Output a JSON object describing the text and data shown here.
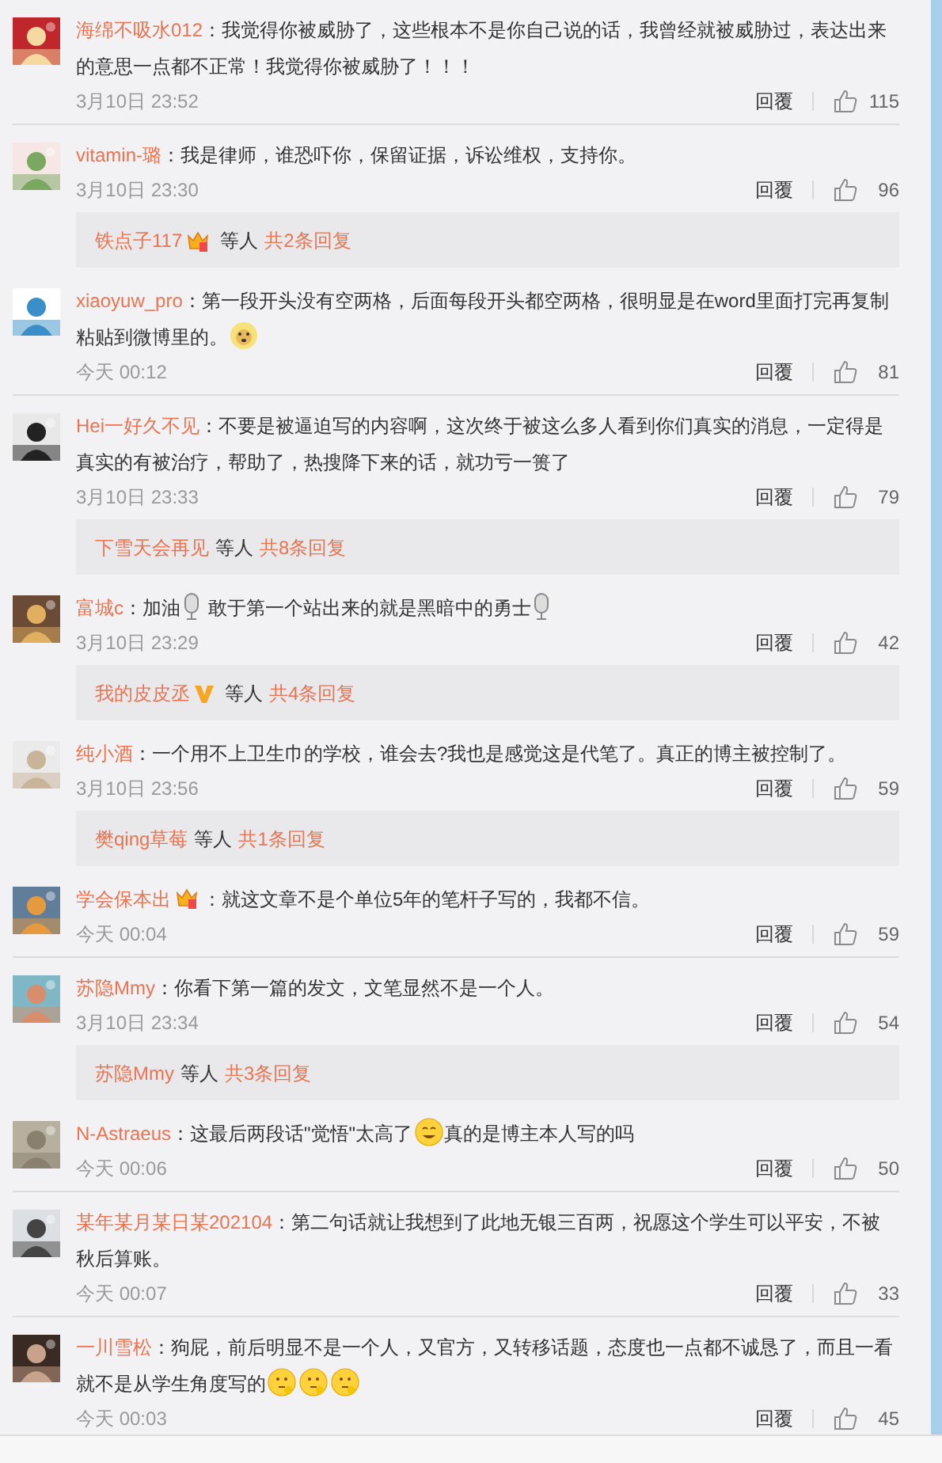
{
  "comments": [
    {
      "user": "海绵不吸水012",
      "separator": "：",
      "content": [
        {
          "kind": "text",
          "value": "我觉得你被威胁了，这些根本不是你自己说的话，我曾经就被威胁过，表达出来的意思一点都不正常！我觉得你被威胁了！！！"
        }
      ],
      "time": "3月10日 23:52",
      "reply_label": "回覆",
      "likes": "115"
    },
    {
      "user": "vitamin-璐",
      "separator": "：",
      "content": [
        {
          "kind": "text",
          "value": "我是律师，谁恐吓你，保留证据，诉讼维权，支持你。"
        }
      ],
      "time": "3月10日 23:30",
      "reply_label": "回覆",
      "likes": "96",
      "replies": {
        "name": "铁点子117",
        "badge": {
          "kind": "crown"
        },
        "others": "等人",
        "count": "共2条回复"
      }
    },
    {
      "user": "xiaoyuw_pro",
      "separator": "：",
      "content": [
        {
          "kind": "text",
          "value": "第一段开头没有空两格，后面每段开头都空两格，很明显是在word里面打完再复制粘贴到微博里的。"
        },
        {
          "kind": "dog"
        }
      ],
      "time": "今天 00:12",
      "reply_label": "回覆",
      "likes": "81"
    },
    {
      "user": "Hei一好久不见",
      "separator": "：",
      "content": [
        {
          "kind": "text",
          "value": "不要是被逼迫写的内容啊，这次终于被这么多人看到你们真实的消息，一定得是真实的有被治疗，帮助了，热搜降下来的话，就功亏一篑了"
        }
      ],
      "time": "3月10日 23:33",
      "reply_label": "回覆",
      "likes": "79",
      "replies": {
        "name": "下雪天会再见",
        "others": "等人",
        "count": "共8条回复"
      }
    },
    {
      "user": "富城c",
      "separator": "：",
      "content": [
        {
          "kind": "text",
          "value": "加油"
        },
        {
          "kind": "mic"
        },
        {
          "kind": "text",
          "value": " 敢于第一个站出来的就是黑暗中的勇士"
        },
        {
          "kind": "mic"
        }
      ],
      "time": "3月10日 23:29",
      "reply_label": "回覆",
      "likes": "42",
      "replies": {
        "name": "我的皮皮丞",
        "badge": {
          "kind": "v"
        },
        "others": "等人",
        "count": "共4条回复"
      }
    },
    {
      "user": "纯小酒",
      "separator": "：",
      "content": [
        {
          "kind": "text",
          "value": "一个用不上卫生巾的学校，谁会去?我也是感觉这是代笔了。真正的博主被控制了。"
        }
      ],
      "time": "3月10日 23:56",
      "reply_label": "回覆",
      "likes": "59",
      "replies": {
        "name": "樊qing草莓",
        "others": "等人",
        "count": "共1条回复"
      }
    },
    {
      "user": "学会保本出",
      "badge": {
        "kind": "crown"
      },
      "separator": "：",
      "content": [
        {
          "kind": "text",
          "value": "就这文章不是个单位5年的笔杆子写的，我都不信。"
        }
      ],
      "time": "今天 00:04",
      "reply_label": "回覆",
      "likes": "59"
    },
    {
      "user": "苏隐Mmy",
      "separator": "：",
      "content": [
        {
          "kind": "text",
          "value": "你看下第一篇的发文，文笔显然不是一个人。"
        }
      ],
      "time": "3月10日 23:34",
      "reply_label": "回覆",
      "likes": "54",
      "replies": {
        "name": "苏隐Mmy",
        "others": "等人",
        "count": "共3条回复"
      }
    },
    {
      "user": "N-Astraeus",
      "separator": "：",
      "content": [
        {
          "kind": "text",
          "value": "这最后两段话\"觉悟\"太高了"
        },
        {
          "kind": "smile"
        },
        {
          "kind": "text",
          "value": "真的是博主本人写的吗"
        }
      ],
      "time": "今天 00:06",
      "reply_label": "回覆",
      "likes": "50"
    },
    {
      "user": "某年某月某日某202104",
      "separator": "：",
      "content": [
        {
          "kind": "text",
          "value": "第二句话就让我想到了此地无银三百两，祝愿这个学生可以平安，不被秋后算账。"
        }
      ],
      "time": "今天 00:07",
      "reply_label": "回覆",
      "likes": "33"
    },
    {
      "user": "一川雪松",
      "separator": "：",
      "content": [
        {
          "kind": "text",
          "value": "狗屁，前后明显不是一个人，又官方，又转移话题，态度也一点都不诚恳了，而且一看就不是从学生角度写的"
        },
        {
          "kind": "think"
        },
        {
          "kind": "think"
        },
        {
          "kind": "think"
        }
      ],
      "time": "今天 00:03",
      "reply_label": "回覆",
      "likes": "45"
    }
  ]
}
